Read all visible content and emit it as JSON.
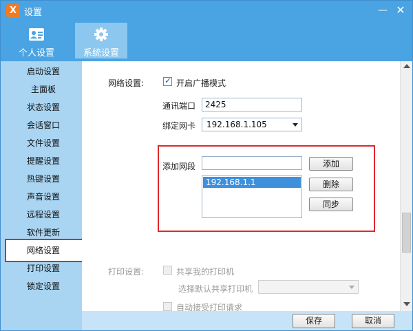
{
  "window": {
    "title": "设置",
    "logo_text": "X"
  },
  "top_tabs": [
    {
      "label": "个人设置",
      "icon": "contact-card-icon"
    },
    {
      "label": "系统设置",
      "icon": "gear-icon",
      "active": true
    }
  ],
  "sidebar": {
    "items": [
      {
        "label": "启动设置"
      },
      {
        "label": "主面板"
      },
      {
        "label": "状态设置"
      },
      {
        "label": "会话窗口"
      },
      {
        "label": "文件设置"
      },
      {
        "label": "提醒设置"
      },
      {
        "label": "热键设置"
      },
      {
        "label": "声音设置"
      },
      {
        "label": "远程设置"
      },
      {
        "label": "软件更新"
      },
      {
        "label": "网络设置",
        "active": true
      },
      {
        "label": "打印设置"
      },
      {
        "label": "锁定设置"
      }
    ]
  },
  "network": {
    "section_label": "网络设置:",
    "broadcast_label": "开启广播模式",
    "broadcast_checked": true,
    "port_label": "通讯端口",
    "port_value": "2425",
    "nic_label": "绑定网卡",
    "nic_value": "192.168.1.105",
    "segment_label": "添加网段",
    "segment_value": "",
    "add_button": "添加",
    "delete_button": "删除",
    "sync_button": "同步",
    "segments": [
      "192.168.1.1"
    ]
  },
  "print": {
    "section_label": "打印设置:",
    "share_label": "共享我的打印机",
    "default_label": "选择默认共享打印机",
    "default_value": "",
    "auto_accept_label": "自动接受打印请求"
  },
  "footer": {
    "save": "保存",
    "cancel": "取消"
  },
  "colors": {
    "accent": "#4aa3e2",
    "sidebar": "#a9d5f3",
    "highlight": "#e0262b",
    "selection": "#3e90dc"
  }
}
